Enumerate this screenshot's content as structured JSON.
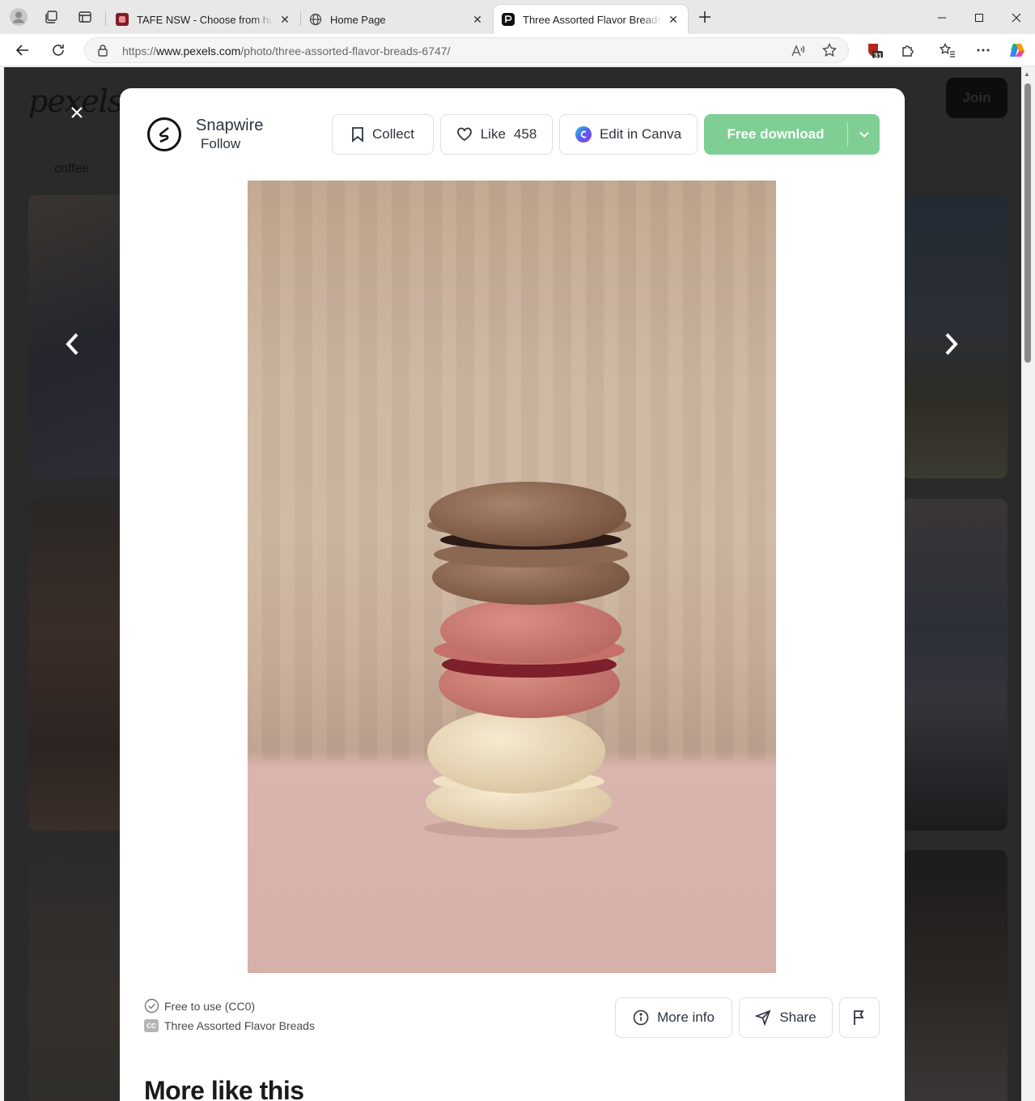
{
  "browser": {
    "tabs": [
      {
        "title": "TAFE NSW - Choose from hundreds of courses",
        "active": false
      },
      {
        "title": "Home Page",
        "active": false
      },
      {
        "title": "Three Assorted Flavor Breads · Free Stock Photo",
        "active": true
      }
    ],
    "url_prefix": "https://",
    "url_domain": "www.pexels.com",
    "url_path": "/photo/three-assorted-flavor-breads-6747/",
    "extension_badge": "31"
  },
  "background_page": {
    "logo": "pexels",
    "join_label": "Join",
    "search_chip": "coffee"
  },
  "modal": {
    "author": {
      "name": "Snapwire",
      "follow_label": "Follow"
    },
    "actions": {
      "collect_label": "Collect",
      "like_label": "Like",
      "like_count": "458",
      "canva_label": "Edit in Canva",
      "download_label": "Free download"
    },
    "photo": {
      "subject": "three stacked macarons"
    },
    "footer": {
      "license": "Free to use (CC0)",
      "photo_title": "Three Assorted Flavor Breads",
      "more_info_label": "More info",
      "share_label": "Share",
      "section_heading": "More like this"
    }
  },
  "colors": {
    "download_green": "#7fcf95",
    "canva_purple": "#7d2ae8",
    "text_dark": "#2c343e"
  }
}
